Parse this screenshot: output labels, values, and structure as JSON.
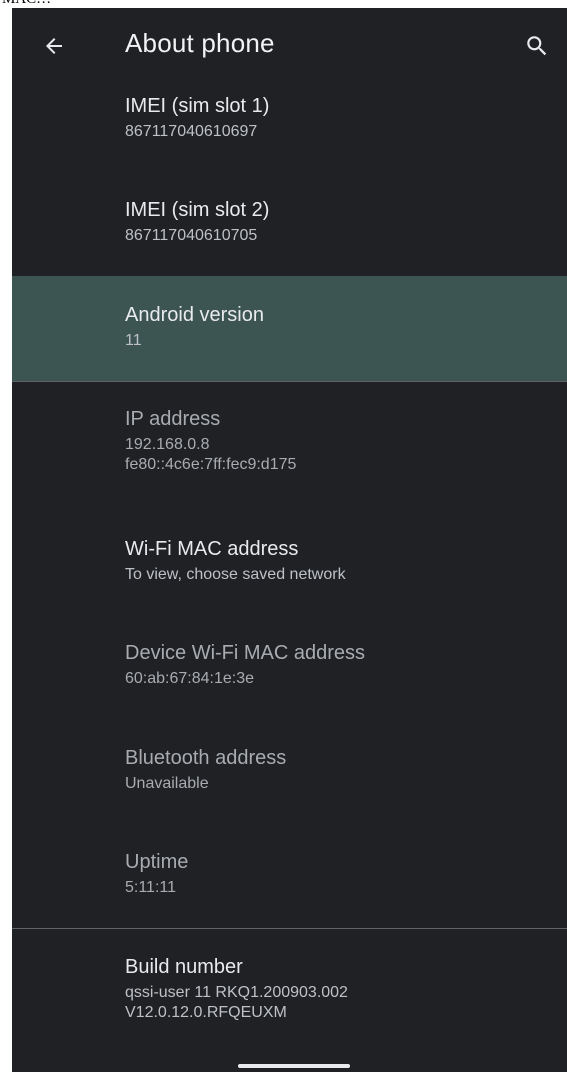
{
  "top_strip_text": "MAC…",
  "app_bar": {
    "title": "About phone",
    "back_icon": "arrow-back-icon",
    "search_icon": "search-icon"
  },
  "items": [
    {
      "label": "IMEI (sim slot 1)",
      "value": "867117040610697"
    },
    {
      "label": "IMEI (sim slot 2)",
      "value": "867117040610705"
    },
    {
      "label": "Android version",
      "value": "11"
    },
    {
      "label": "IP address",
      "value": "192.168.0.8",
      "value2": "fe80::4c6e:7ff:fec9:d175"
    },
    {
      "label": "Wi-Fi MAC address",
      "value": "To view, choose saved network"
    },
    {
      "label": "Device Wi-Fi MAC address",
      "value": "60:ab:67:84:1e:3e"
    },
    {
      "label": "Bluetooth address",
      "value": "Unavailable"
    },
    {
      "label": "Uptime",
      "value": "5:11:11"
    },
    {
      "label": "Build number",
      "value": "qssi-user 11 RKQ1.200903.002",
      "value2": "V12.0.12.0.RFQEUXM"
    }
  ],
  "colors": {
    "background": "#202124",
    "highlight": "#3c5553",
    "text_primary": "#e8eaed",
    "text_secondary": "#bdc1c6",
    "text_dim": "#a8acb0"
  }
}
